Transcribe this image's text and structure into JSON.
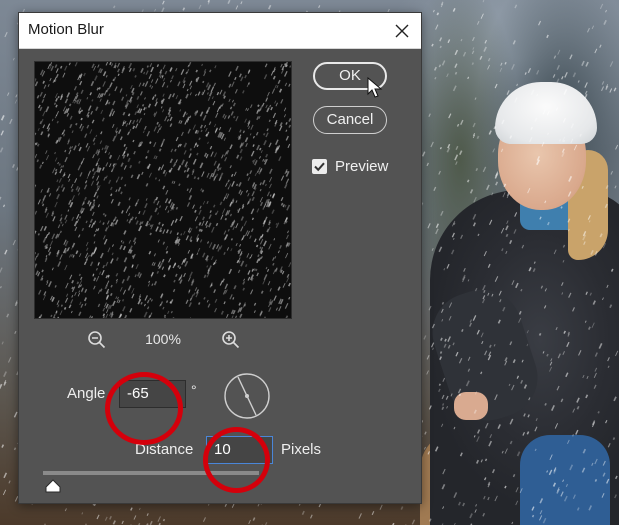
{
  "dialog": {
    "title": "Motion Blur",
    "ok_label": "OK",
    "cancel_label": "Cancel",
    "preview_label": "Preview",
    "preview_checked": true,
    "zoom_level": "100%",
    "angle": {
      "label": "Angle",
      "value": "-65",
      "unit": "°"
    },
    "distance": {
      "label": "Distance",
      "value": "10",
      "unit": "Pixels",
      "slider_fraction": 0.04
    }
  },
  "icons": {
    "close": "close-icon",
    "zoom_out": "zoom-out-icon",
    "zoom_in": "zoom-in-icon",
    "checkbox": "checkmark-icon",
    "cursor": "mouse-pointer-icon",
    "angle_dial": "angle-dial-icon",
    "slider_thumb": "slider-thumb-icon"
  },
  "colors": {
    "dialog_bg": "#535353",
    "annotation_ring": "#d4000b",
    "focus_border": "#4a86d8"
  }
}
